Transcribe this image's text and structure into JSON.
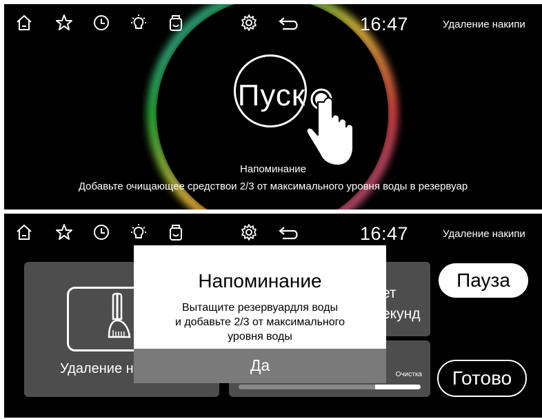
{
  "status_bar": {
    "time": "16:47",
    "mode_label": "Удаление накипи",
    "icons": [
      "home-icon",
      "star-icon",
      "clock-icon",
      "bulb-icon",
      "container-icon",
      "gear-icon",
      "back-arrow-icon"
    ]
  },
  "screen1": {
    "start_label": "Пуск",
    "reminder_title": "Напоминание",
    "reminder_text": "Добавьте очищающее средствои 2/3 от максимального уровня воды в резервуар"
  },
  "screen2": {
    "card_left_label": "Удаление н",
    "card_right_top": {
      "line1": "ет",
      "line2": "екунд"
    },
    "progress": {
      "label": "Очистка",
      "value": 0.25
    },
    "pause_label": "Пауза",
    "done_label": "Готово",
    "modal": {
      "title": "Напоминание",
      "line1": "Вытащите резервуардля воды",
      "line2": "и добавьте 2/3 от максимального",
      "line3": "уровня воды",
      "button": "Да"
    }
  },
  "colors": {
    "background": "#000000",
    "card": "#4d4d4d",
    "modal_button": "#7a7a7a",
    "ring": [
      "#2ecc40",
      "#ffd23f",
      "#ff4d4d",
      "#9b59b6",
      "#3fa9f5"
    ]
  }
}
